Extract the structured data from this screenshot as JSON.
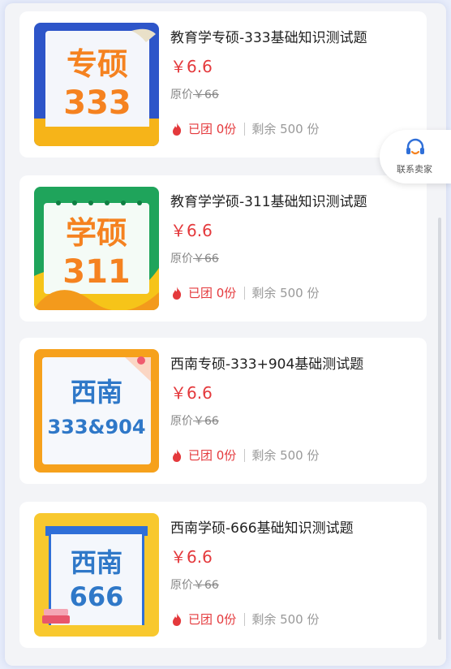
{
  "products": [
    {
      "title": "教育学专硕-333基础知识测试题",
      "price": "￥6.6",
      "original_label": "原价",
      "original_price": "￥66",
      "grouped": "已团 0份",
      "remaining": "剩余 500 份",
      "cover_line1": "专硕",
      "cover_line2": "333"
    },
    {
      "title": "教育学学硕-311基础知识测试题",
      "price": "￥6.6",
      "original_label": "原价",
      "original_price": "￥66",
      "grouped": "已团 0份",
      "remaining": "剩余 500 份",
      "cover_line1": "学硕",
      "cover_line2": "311"
    },
    {
      "title": "西南专硕-333+904基础测试题",
      "price": "￥6.6",
      "original_label": "原价",
      "original_price": "￥66",
      "grouped": "已团 0份",
      "remaining": "剩余 500 份",
      "cover_line1": "西南",
      "cover_line2": "333&904"
    },
    {
      "title": "西南学硕-666基础知识测试题",
      "price": "￥6.6",
      "original_label": "原价",
      "original_price": "￥66",
      "grouped": "已团 0份",
      "remaining": "剩余 500 份",
      "cover_line1": "西南",
      "cover_line2": "666"
    }
  ],
  "contact": {
    "label": "联系卖家",
    "icon": "headset-icon"
  },
  "colors": {
    "price_red": "#e4393c",
    "accent_orange": "#f58220",
    "cover_blue": "#2f6fd8"
  }
}
